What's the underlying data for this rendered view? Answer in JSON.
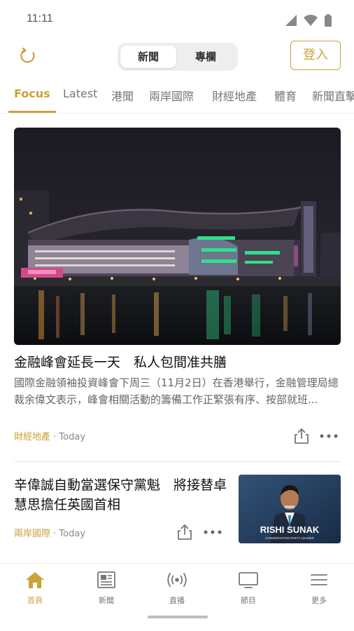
{
  "status": {
    "time": "11:11"
  },
  "header": {
    "segments": [
      "新聞",
      "專欄"
    ],
    "login_label": "登入"
  },
  "tabs": [
    "Focus",
    "Latest",
    "港聞",
    "兩岸國際",
    "財經地產",
    "體育",
    "新聞直擊"
  ],
  "articles": [
    {
      "title": "金融峰會延長一天　私人包間准共膳",
      "summary": "國際金融領袖投資峰會下周三（11月2日）在香港舉行，金融管理局總裁余偉文表示，峰會相關活動的籌備工作正緊張有序、按部就班...",
      "category": "財經地產",
      "time": "Today",
      "image": "harbour-night-convention-centre"
    },
    {
      "title": "辛偉誠自動當選保守黨魁　將接替卓慧思擔任英國首相",
      "category": "兩岸國際",
      "time": "Today",
      "image_caption": "RISHI SUNAK",
      "image_subcaption": "CONSERVATIVE PARTY LEADER"
    }
  ],
  "meta_separator": " · ",
  "bottom_nav": [
    {
      "label": "首頁",
      "icon": "home-icon"
    },
    {
      "label": "新聞",
      "icon": "newspaper-icon"
    },
    {
      "label": "直播",
      "icon": "live-broadcast-icon"
    },
    {
      "label": "節目",
      "icon": "tv-icon"
    },
    {
      "label": "更多",
      "icon": "menu-icon"
    }
  ],
  "colors": {
    "accent": "#c9a23c",
    "text": "#111111",
    "muted": "#777777"
  }
}
